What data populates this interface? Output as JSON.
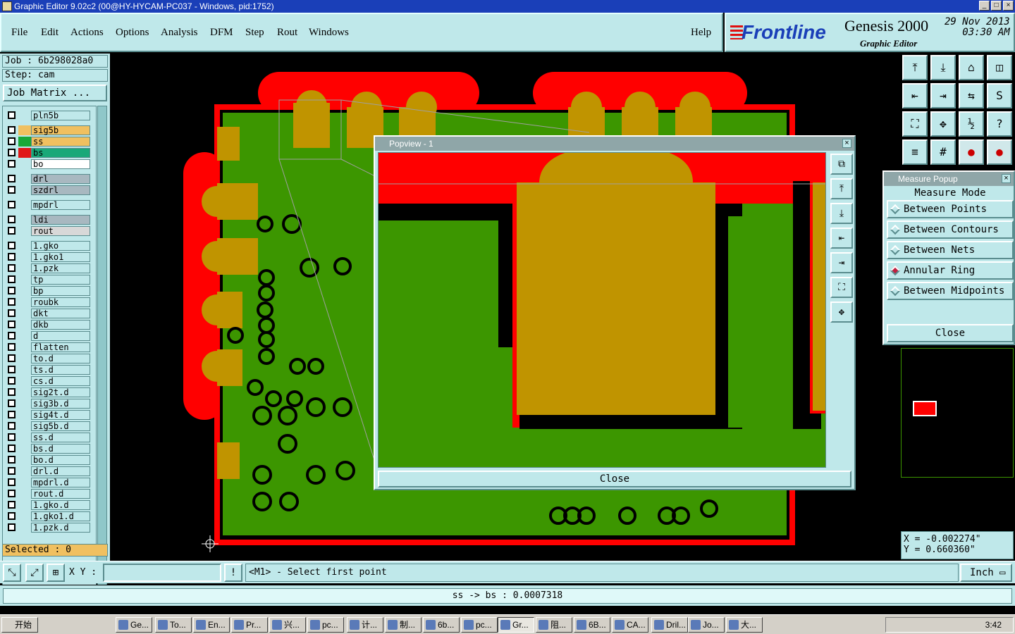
{
  "window": {
    "title": "Graphic Editor 9.02c2 (00@HY-HYCAM-PC037 - Windows, pid:1752)"
  },
  "menu": [
    "File",
    "Edit",
    "Actions",
    "Options",
    "Analysis",
    "DFM",
    "Step",
    "Rout",
    "Windows"
  ],
  "help": "Help",
  "brand": {
    "logo": "Frontline",
    "product": "Genesis 2000",
    "subtitle": "Graphic Editor",
    "date": "29 Nov 2013",
    "time": "03:30 AM"
  },
  "job": {
    "job_label": "Job : 6b298028a0",
    "step_label": "Step: cam",
    "matrix_button": "Job Matrix ..."
  },
  "layers": [
    {
      "name": "pln5b",
      "color": "#bfe8ea",
      "bg": "#bfe8ea"
    },
    {
      "name": "sig5b",
      "color": "#f0c060",
      "bg": "#f0c060"
    },
    {
      "name": "ss",
      "color": "#18a838",
      "bg": "#f0c060"
    },
    {
      "name": "bs",
      "color": "#e01818",
      "bg": "#18a878"
    },
    {
      "name": "bo",
      "color": "#bfe8ea",
      "bg": "#ffffff"
    },
    {
      "name": "drl",
      "color": "#bfe8ea",
      "bg": "#a8b8c0"
    },
    {
      "name": "szdrl",
      "color": "#bfe8ea",
      "bg": "#a8b8c0"
    },
    {
      "name": "mpdrl",
      "color": "#bfe8ea",
      "bg": "#bfe8ea"
    },
    {
      "name": "ldi",
      "color": "#bfe8ea",
      "bg": "#a8b8c0"
    },
    {
      "name": "rout",
      "color": "#bfe8ea",
      "bg": "#d8d8d8"
    },
    {
      "name": "1.gko",
      "color": "#bfe8ea",
      "bg": "#bfe8ea"
    },
    {
      "name": "1.gko1",
      "color": "#bfe8ea",
      "bg": "#bfe8ea"
    },
    {
      "name": "1.pzk",
      "color": "#bfe8ea",
      "bg": "#bfe8ea"
    },
    {
      "name": "tp",
      "color": "#bfe8ea",
      "bg": "#bfe8ea"
    },
    {
      "name": "bp",
      "color": "#bfe8ea",
      "bg": "#bfe8ea"
    },
    {
      "name": "roubk",
      "color": "#bfe8ea",
      "bg": "#bfe8ea"
    },
    {
      "name": "dkt",
      "color": "#bfe8ea",
      "bg": "#bfe8ea"
    },
    {
      "name": "dkb",
      "color": "#bfe8ea",
      "bg": "#bfe8ea"
    },
    {
      "name": "d",
      "color": "#bfe8ea",
      "bg": "#bfe8ea"
    },
    {
      "name": "flatten",
      "color": "#bfe8ea",
      "bg": "#bfe8ea"
    },
    {
      "name": "to.d",
      "color": "#bfe8ea",
      "bg": "#bfe8ea"
    },
    {
      "name": "ts.d",
      "color": "#bfe8ea",
      "bg": "#bfe8ea"
    },
    {
      "name": "cs.d",
      "color": "#bfe8ea",
      "bg": "#bfe8ea"
    },
    {
      "name": "sig2t.d",
      "color": "#bfe8ea",
      "bg": "#bfe8ea"
    },
    {
      "name": "sig3b.d",
      "color": "#bfe8ea",
      "bg": "#bfe8ea"
    },
    {
      "name": "sig4t.d",
      "color": "#bfe8ea",
      "bg": "#bfe8ea"
    },
    {
      "name": "sig5b.d",
      "color": "#bfe8ea",
      "bg": "#bfe8ea"
    },
    {
      "name": "ss.d",
      "color": "#bfe8ea",
      "bg": "#bfe8ea"
    },
    {
      "name": "bs.d",
      "color": "#bfe8ea",
      "bg": "#bfe8ea"
    },
    {
      "name": "bo.d",
      "color": "#bfe8ea",
      "bg": "#bfe8ea"
    },
    {
      "name": "drl.d",
      "color": "#bfe8ea",
      "bg": "#bfe8ea"
    },
    {
      "name": "mpdrl.d",
      "color": "#bfe8ea",
      "bg": "#bfe8ea"
    },
    {
      "name": "rout.d",
      "color": "#bfe8ea",
      "bg": "#bfe8ea"
    },
    {
      "name": "1.gko.d",
      "color": "#bfe8ea",
      "bg": "#bfe8ea"
    },
    {
      "name": "1.gko1.d",
      "color": "#bfe8ea",
      "bg": "#bfe8ea"
    },
    {
      "name": "1.pzk.d",
      "color": "#bfe8ea",
      "bg": "#bfe8ea"
    }
  ],
  "selected": "Selected : 0",
  "popview": {
    "title": "Popview - 1",
    "close": "Close"
  },
  "measure": {
    "title": "Measure Popup",
    "heading": "Measure Mode",
    "options": [
      "Between Points",
      "Between Contours",
      "Between Nets",
      "Annular Ring",
      "Between Midpoints"
    ],
    "selected": "Annular Ring",
    "close": "Close"
  },
  "coords": {
    "x": "X = -0.002274\"",
    "y": "Y = 0.660360\""
  },
  "bottom": {
    "xy_label": "X Y :",
    "xy_value": "",
    "prompt": "<M1> - Select first point",
    "unit": "Inch"
  },
  "status": "ss -> bs : 0.0007318",
  "taskbar": {
    "start": "开始",
    "tasks": [
      "Ge...",
      "To...",
      "En...",
      "Pr...",
      "兴...",
      "pc...",
      "计...",
      "制...",
      "6b...",
      "pc...",
      "Gr...",
      "阻...",
      "6B...",
      "CA...",
      "Dril...",
      "Jo...",
      "大..."
    ],
    "active": "Gr...",
    "clock": "3:42"
  },
  "colors": {
    "panel": "#bfe8ea",
    "copper": "#c09400",
    "mask": "#ff0000",
    "ground": "#3c9600"
  }
}
